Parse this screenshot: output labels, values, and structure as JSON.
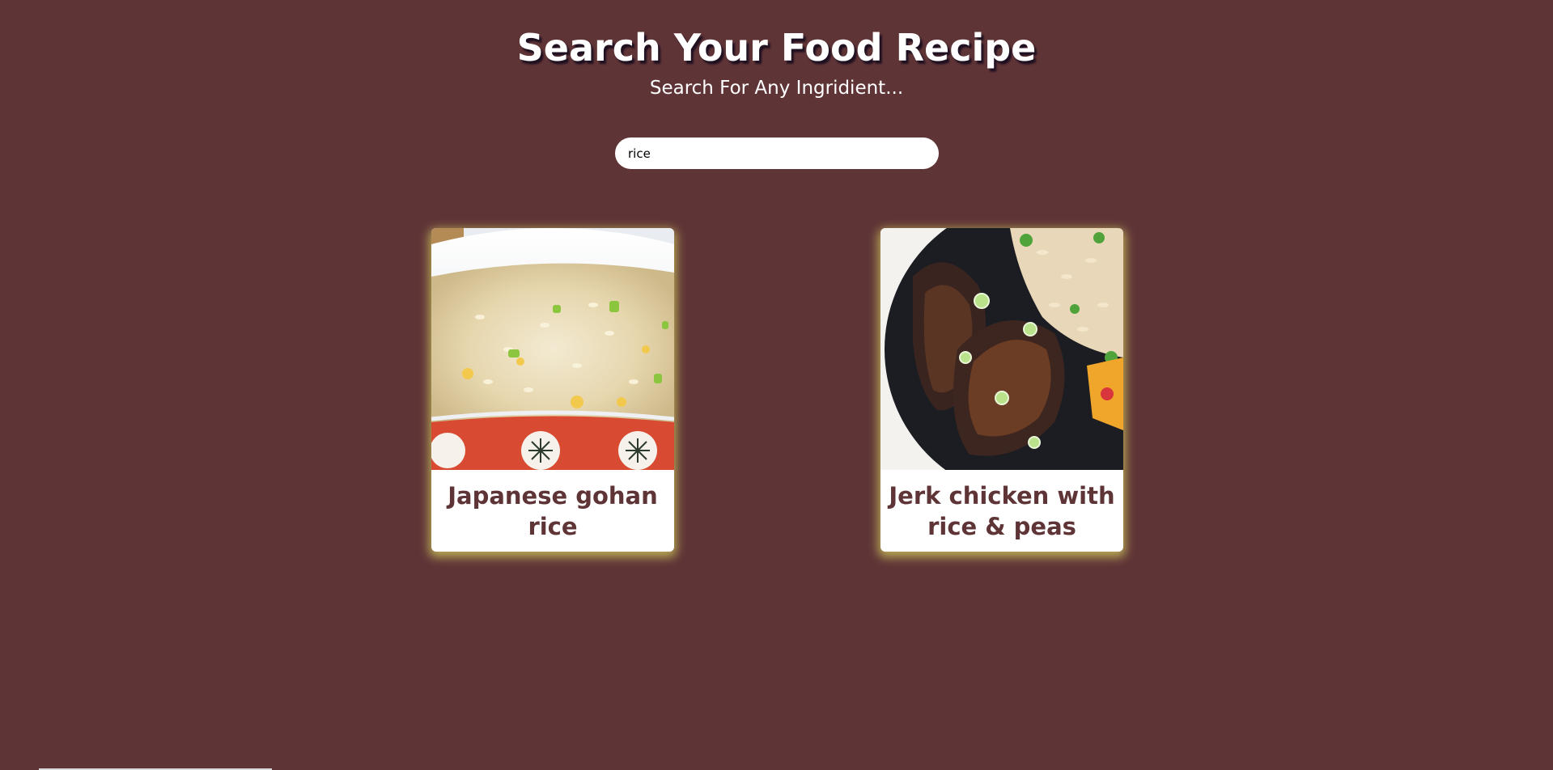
{
  "header": {
    "title": "Search Your Food Recipe",
    "subtitle": "Search For Any Ingridient..."
  },
  "search": {
    "value": "rice",
    "placeholder": ""
  },
  "recipes": [
    {
      "title": "Japanese gohan rice",
      "image_icon": "rice-bowl-photo"
    },
    {
      "title": "Jerk chicken with rice & peas",
      "image_icon": "jerk-chicken-photo"
    }
  ],
  "colors": {
    "background": "#5f3437",
    "card_title": "#5f3437",
    "card_glow": "#d6d260"
  }
}
